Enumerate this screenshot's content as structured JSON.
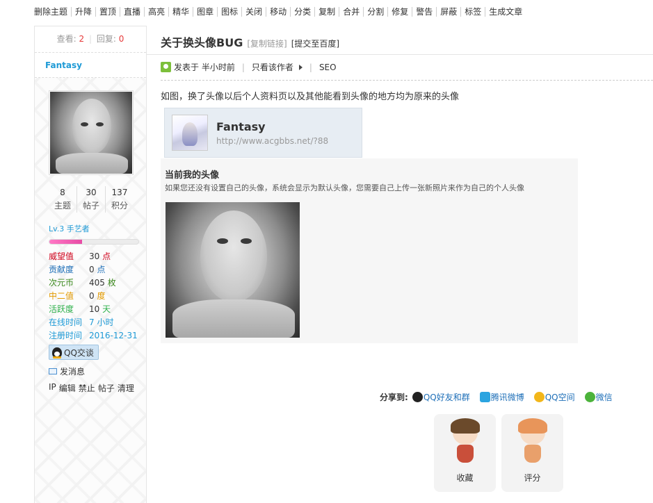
{
  "modbar": [
    "删除主题",
    "升降",
    "置顶",
    "直播",
    "高亮",
    "精华",
    "图章",
    "图标",
    "关闭",
    "移动",
    "分类",
    "复制",
    "合并",
    "分割",
    "修复",
    "警告",
    "屏蔽",
    "标签",
    "生成文章"
  ],
  "user": {
    "views_label": "查看:",
    "views": "2",
    "replies_label": "回复:",
    "replies": "0",
    "name": "Fantasy",
    "counts": [
      {
        "num": "8",
        "label": "主题"
      },
      {
        "num": "30",
        "label": "帖子"
      },
      {
        "num": "137",
        "label": "积分"
      }
    ],
    "level": "Lv.3 手艺者",
    "level_progress": 0.37,
    "profile": [
      {
        "label": "威望值",
        "value": "30",
        "unit": "点",
        "color": "#d0021b"
      },
      {
        "label": "贡献度",
        "value": "0",
        "unit": "点",
        "color": "#1e6fb8"
      },
      {
        "label": "次元币",
        "value": "405",
        "unit": "枚",
        "color": "#3c8a1e"
      },
      {
        "label": "中二值",
        "value": "0",
        "unit": "度",
        "color": "#e49b00"
      },
      {
        "label": "活跃度",
        "value": "10",
        "unit": "天",
        "color": "#2fb14c"
      },
      {
        "label": "在线时间",
        "value": "7",
        "unit": "小时",
        "color": "#1e9ad6"
      },
      {
        "label": "注册时间",
        "value": "2016-12-31",
        "unit": "",
        "color": "#1e9ad6"
      }
    ],
    "qq_button": "QQ交谈",
    "message": "发消息",
    "admin_links": [
      "IP",
      "编辑",
      "禁止",
      "帖子",
      "清理"
    ]
  },
  "thread": {
    "title": "关于换头像BUG",
    "copy_link": "[复制链接]",
    "submit_baidu": "[提交至百度]",
    "posted": "发表于 半小时前",
    "only_author": "只看该作者",
    "seo": "SEO",
    "body": "如图，换了头像以后个人资料页以及其他能看到头像的地方均为原来的头像"
  },
  "screenshot": {
    "name": "Fantasy",
    "url": "http://www.acgbbs.net/?88",
    "panel_title": "当前我的头像",
    "panel_desc": "如果您还没有设置自己的头像，系统会显示为默认头像，您需要自己上传一张新照片来作为自己的个人头像"
  },
  "share": {
    "label": "分享到:",
    "items": [
      {
        "label": "QQ好友和群",
        "icon": "qq-icon"
      },
      {
        "label": "腾讯微博",
        "icon": "tencent-weibo-icon"
      },
      {
        "label": "QQ空间",
        "icon": "qzone-icon"
      },
      {
        "label": "微信",
        "icon": "wechat-icon"
      }
    ]
  },
  "actions": [
    {
      "label": "收藏",
      "icon": "favorite-mascot-icon"
    },
    {
      "label": "评分",
      "icon": "rate-mascot-icon"
    }
  ]
}
